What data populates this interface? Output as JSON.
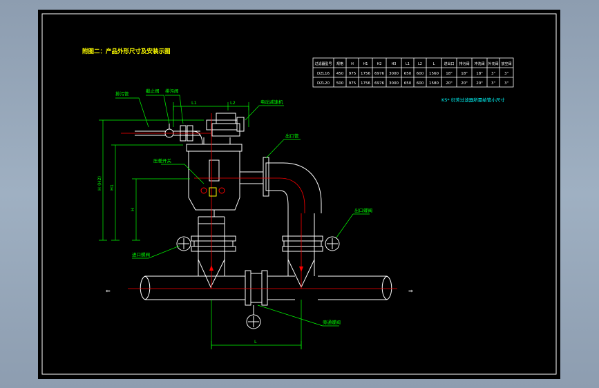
{
  "title": "附图二：产品外形尺寸及安装示图",
  "note": "KS* 衍芳过滤器所需给管小尺寸",
  "table": {
    "headers": [
      "过滤器型号",
      "规格",
      "H",
      "H1",
      "H2",
      "H3",
      "L1",
      "L2",
      "L",
      "进出口",
      "排污阀",
      "冲洗阀",
      "补充阀",
      "放空阀"
    ],
    "rows": [
      [
        "DZL16",
        "450",
        "975",
        "1756",
        "6976",
        "3000",
        "650",
        "600",
        "1560",
        "18\"",
        "18\"",
        "18\"",
        "3\"",
        "3\""
      ],
      [
        "DZL20",
        "500",
        "975",
        "1756",
        "6976",
        "3000",
        "650",
        "600",
        "1580",
        "20\"",
        "20\"",
        "20\"",
        "3\"",
        "3\""
      ]
    ]
  },
  "labels": {
    "drain_pipe": "排污管",
    "flush_valve": "截止阀",
    "drain_valve": "排污阀",
    "motor": "电动减速机",
    "pressure_gauge": "压差开关",
    "outlet_pipe": "出口管",
    "inlet_valve": "进口蝶阀",
    "outlet_valve": "出口蝶阀",
    "bypass_valve": "旁通蝶阀"
  },
  "dims": {
    "L1": "L1",
    "L2": "L2",
    "L": "L",
    "H_total": "H (H2)",
    "H1": "H1",
    "H2": "H"
  },
  "flow_arrows": {
    "left": "⇐",
    "right": "⇒"
  },
  "colors": {
    "background": "#000000",
    "frame": "#ffffff",
    "dimension": "#00ff00",
    "centerline": "#ff0000",
    "title_text": "#ffff00",
    "table_text": "#ffffff",
    "note_text": "#00ffff"
  }
}
